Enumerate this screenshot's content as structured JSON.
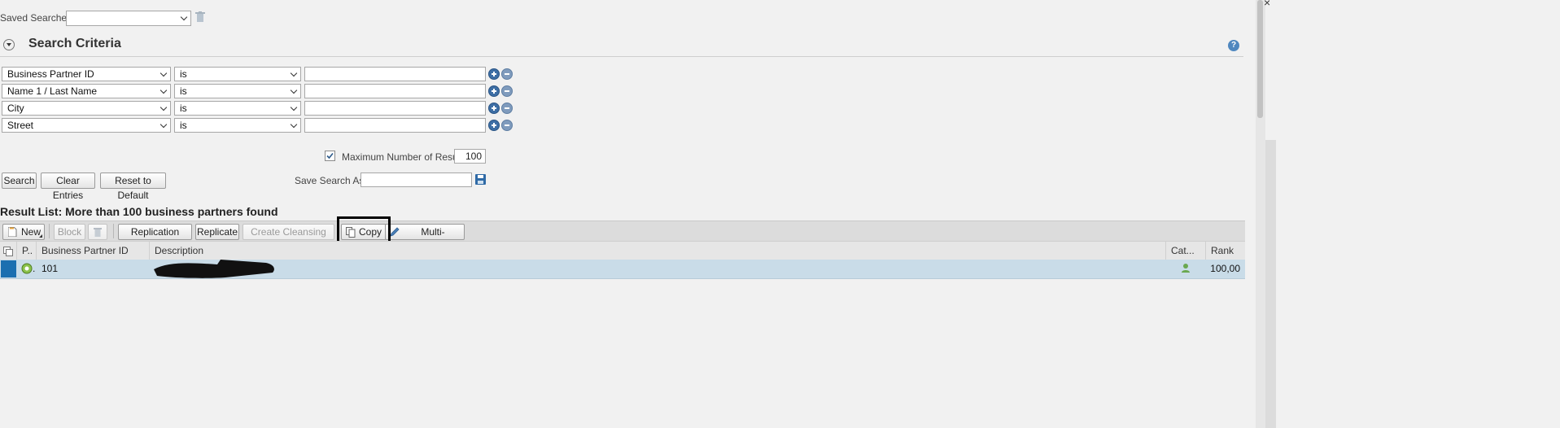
{
  "saved_searches": {
    "label": "Saved Searches:",
    "value": ""
  },
  "search_criteria": {
    "title": "Search Criteria",
    "rows": [
      {
        "field": "Business Partner ID",
        "operator": "is",
        "value": ""
      },
      {
        "field": "Name 1 / Last Name",
        "operator": "is",
        "value": ""
      },
      {
        "field": "City",
        "operator": "is",
        "value": ""
      },
      {
        "field": "Street",
        "operator": "is",
        "value": ""
      }
    ],
    "max_results_label": "Maximum Number of Results:",
    "max_results_value": "100",
    "max_results_checked": true,
    "save_search_label": "Save Search As:",
    "save_search_value": "",
    "buttons": {
      "search": "Search",
      "clear": "Clear Entries",
      "reset": "Reset to Default"
    }
  },
  "result_list": {
    "title": "Result List: More than 100 business partners found",
    "toolbar": {
      "new": "New",
      "block": "Block",
      "replication_status": "Replication Status",
      "replicate": "Replicate",
      "create_cleansing_case": "Create Cleansing Case",
      "copy": "Copy",
      "multi_processing": "Multi-Processing"
    },
    "columns": {
      "p": "P..",
      "bp_id": "Business Partner ID",
      "description": "Description",
      "category": "Cat...",
      "rank": "Rank"
    },
    "rows": [
      {
        "bp_id": "101",
        "description": "",
        "rank": "100,00"
      }
    ]
  },
  "colors": {
    "accent": "#3d6ea5",
    "selected_row": "#c9dce8",
    "highlight_box": "#000000"
  }
}
